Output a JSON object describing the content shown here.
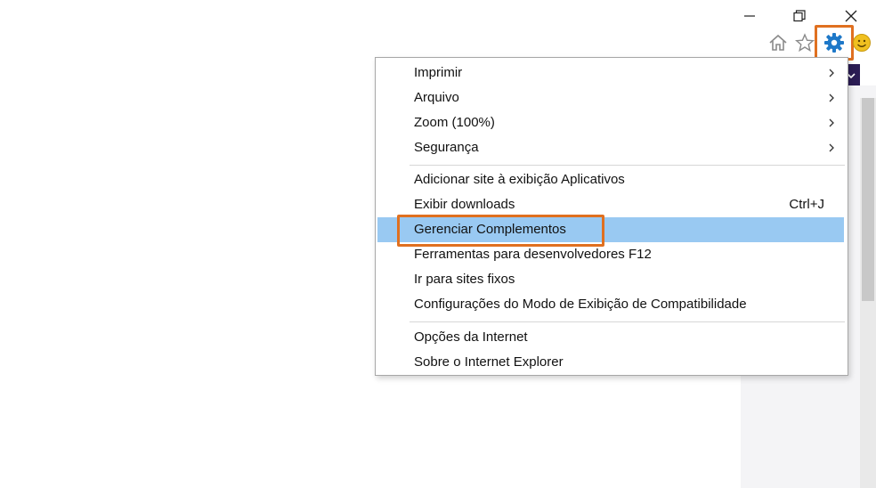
{
  "menu": {
    "items": [
      {
        "label": "Imprimir",
        "submenu": true
      },
      {
        "label": "Arquivo",
        "submenu": true
      },
      {
        "label": "Zoom (100%)",
        "submenu": true
      },
      {
        "label": "Segurança",
        "submenu": true
      },
      {
        "label": "Adicionar site à exibição Aplicativos"
      },
      {
        "label": "Exibir downloads",
        "shortcut": "Ctrl+J"
      },
      {
        "label": "Gerenciar Complementos",
        "highlighted": true
      },
      {
        "label": "Ferramentas para desenvolvedores F12"
      },
      {
        "label": "Ir para sites fixos"
      },
      {
        "label": "Configurações do Modo de Exibição de Compatibilidade"
      },
      {
        "label": "Opções da Internet"
      },
      {
        "label": "Sobre o Internet Explorer"
      }
    ]
  },
  "window_controls": [
    "minimize-icon",
    "restore-icon",
    "close-icon"
  ],
  "toolbar_icons": [
    "home-icon",
    "star-icon",
    "gear-icon",
    "smiley-icon"
  ],
  "colors": {
    "highlight": "#99c9f2",
    "annotation": "#e07020",
    "gear": "#1e78c8",
    "smiley": "#f0c020"
  }
}
